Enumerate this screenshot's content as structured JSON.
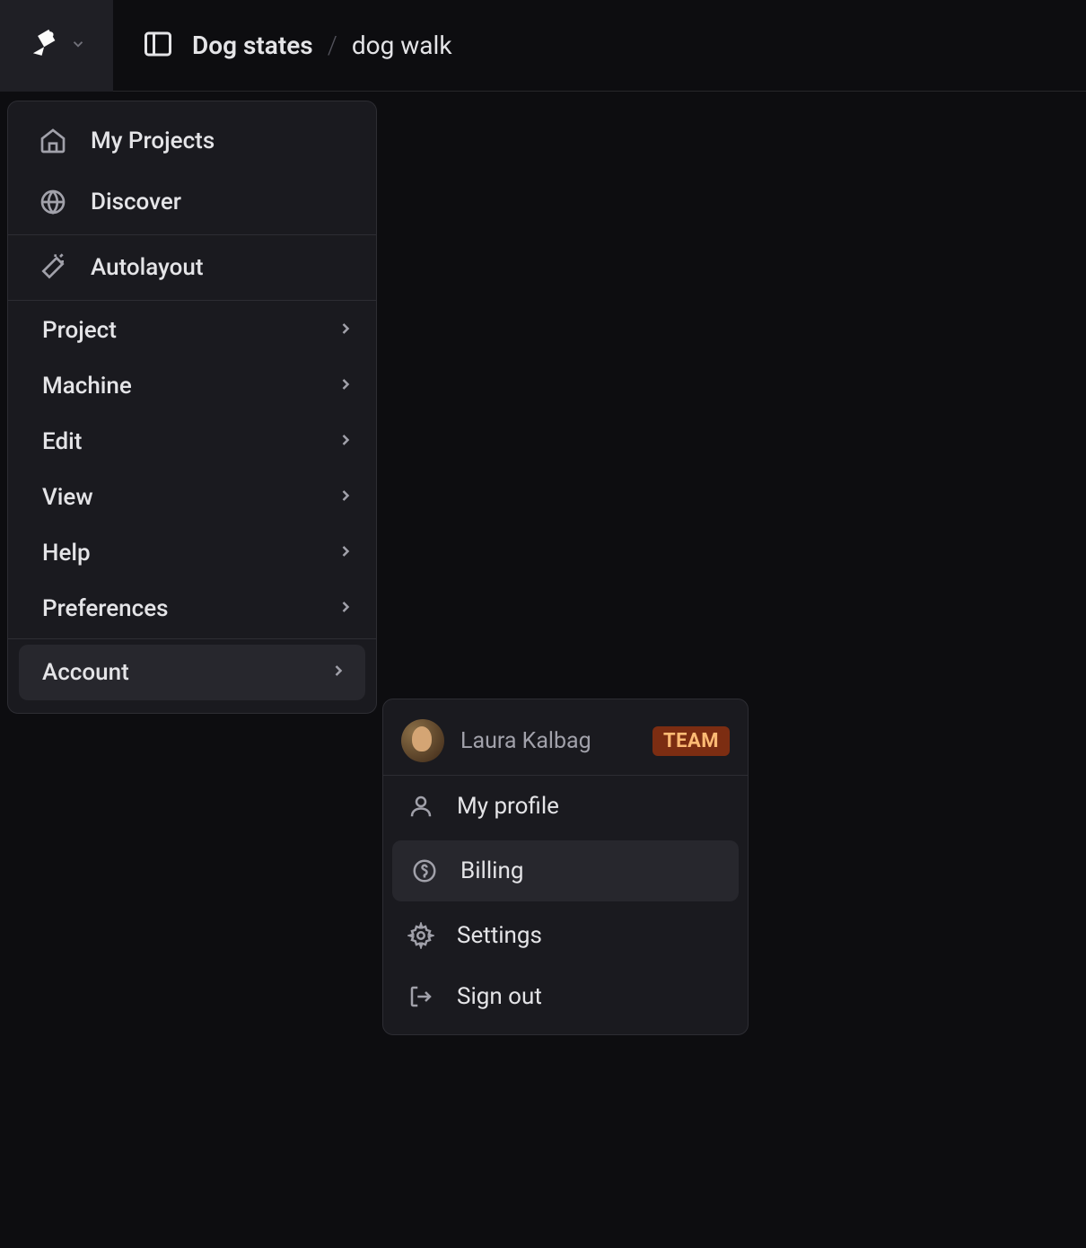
{
  "breadcrumb": {
    "project": "Dog states",
    "item": "dog walk"
  },
  "main_menu": {
    "top": [
      {
        "label": "My Projects",
        "icon": "home-icon"
      },
      {
        "label": "Discover",
        "icon": "globe-icon"
      }
    ],
    "autolayout": {
      "label": "Autolayout",
      "icon": "wand-icon"
    },
    "submenus": [
      {
        "label": "Project"
      },
      {
        "label": "Machine"
      },
      {
        "label": "Edit"
      },
      {
        "label": "View"
      },
      {
        "label": "Help"
      },
      {
        "label": "Preferences"
      }
    ],
    "account": {
      "label": "Account"
    }
  },
  "account_menu": {
    "user": "Laura Kalbag",
    "badge": "TEAM",
    "items": [
      {
        "label": "My profile",
        "icon": "person-icon"
      },
      {
        "label": "Billing",
        "icon": "dollar-circle-icon",
        "highlighted": true
      },
      {
        "label": "Settings",
        "icon": "gear-icon"
      },
      {
        "label": "Sign out",
        "icon": "sign-out-icon"
      }
    ]
  }
}
